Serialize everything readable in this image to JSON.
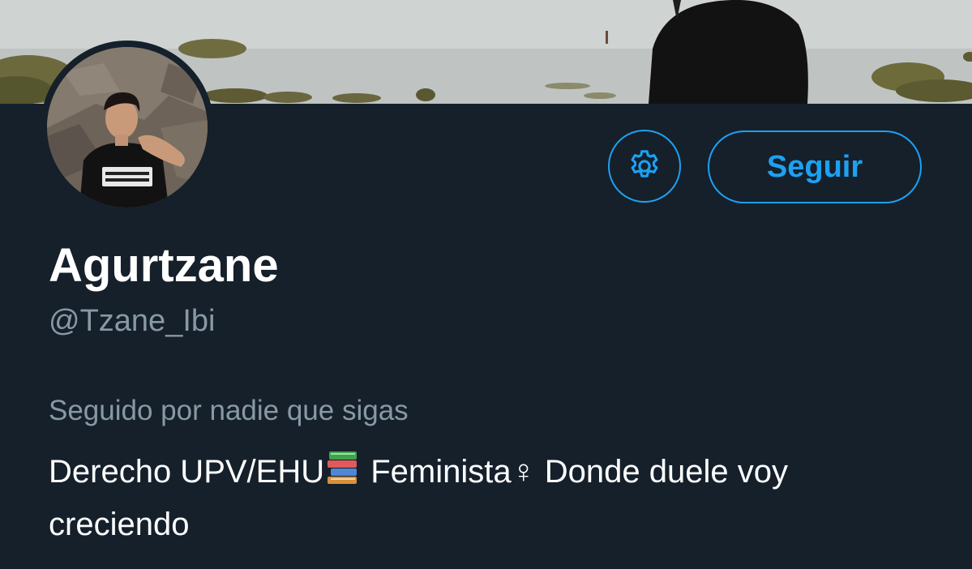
{
  "profile": {
    "display_name": "Agurtzane",
    "handle": "@Tzane_Ibi",
    "followed_by": "Seguido por nadie que sigas",
    "bio_part1": "Derecho UPV/EHU",
    "bio_icon": "books-emoji",
    "bio_part2": " Feminista♀︎  Donde duele voy creciendo"
  },
  "actions": {
    "settings_icon": "gear-icon",
    "follow_label": "Seguir"
  },
  "colors": {
    "background": "#15202b",
    "accent": "#1da1f2",
    "secondary_text": "#8899a6",
    "primary_text": "#ffffff"
  }
}
